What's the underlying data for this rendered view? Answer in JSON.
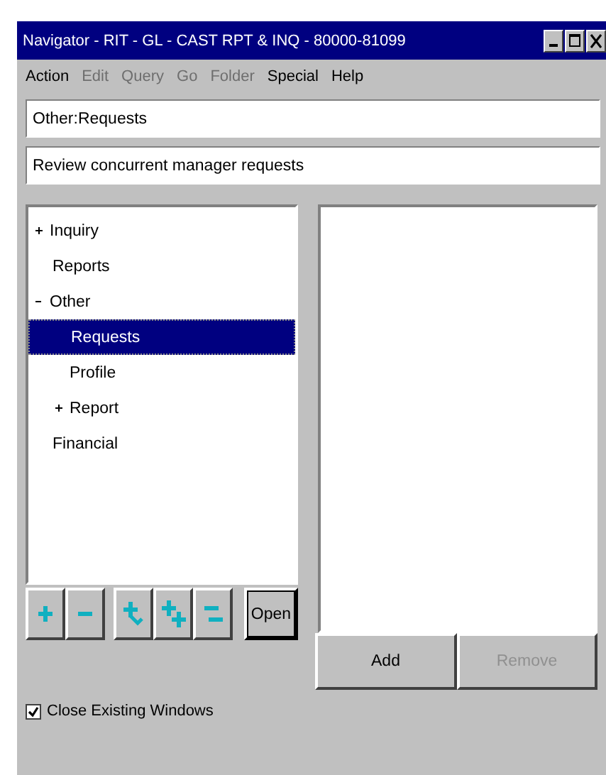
{
  "window": {
    "title": "Navigator - RIT - GL - CAST RPT & INQ - 80000-81099"
  },
  "menu": [
    {
      "label": "Action",
      "disabled": false
    },
    {
      "label": "Edit",
      "disabled": true
    },
    {
      "label": "Query",
      "disabled": true
    },
    {
      "label": "Go",
      "disabled": true
    },
    {
      "label": "Folder",
      "disabled": true
    },
    {
      "label": "Special",
      "disabled": false
    },
    {
      "label": "Help",
      "disabled": false
    }
  ],
  "path_field": {
    "value": "Other:Requests"
  },
  "description_field": {
    "value": "Review concurrent manager requests"
  },
  "tree": [
    {
      "label": "Inquiry",
      "expanded": false,
      "selected": false
    },
    {
      "label": "Reports",
      "selected": false
    },
    {
      "label": "Other",
      "expanded": true,
      "selected": false,
      "children": [
        {
          "label": "Requests",
          "selected": true
        },
        {
          "label": "Profile",
          "selected": false
        },
        {
          "label": "Report",
          "expanded": false,
          "selected": false
        }
      ]
    },
    {
      "label": "Financial",
      "selected": false
    }
  ],
  "tool_buttons": [
    {
      "kind": "expand"
    },
    {
      "kind": "collapse"
    },
    {
      "kind": "expand-branch"
    },
    {
      "kind": "expand-all"
    },
    {
      "kind": "collapse-all"
    }
  ],
  "open_button": {
    "label": "Open"
  },
  "add_button": {
    "label": "Add",
    "disabled": false
  },
  "remove_button": {
    "label": "Remove",
    "disabled": true
  },
  "close_existing_windows": {
    "label": "Close Existing Windows",
    "checked": true
  }
}
